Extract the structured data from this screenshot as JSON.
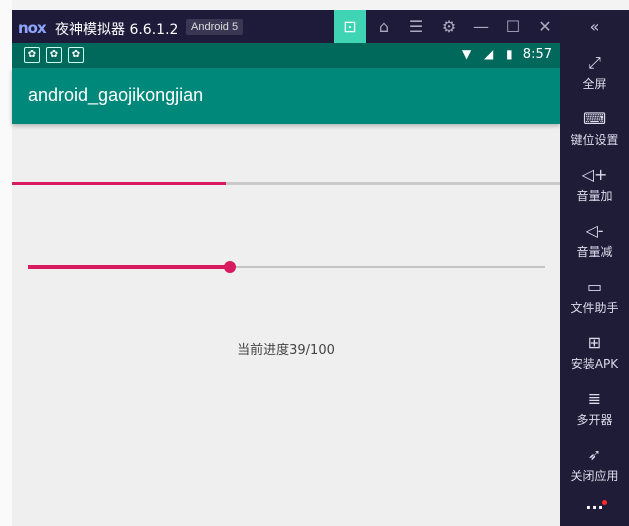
{
  "emulator": {
    "logo": "nox",
    "title": "夜神模拟器 6.6.1.2",
    "android_badge": "Android 5",
    "controls": [
      {
        "name": "store-icon",
        "glyph": "⊡"
      },
      {
        "name": "skin-icon",
        "glyph": "⌂"
      },
      {
        "name": "menu-icon",
        "glyph": "☰"
      },
      {
        "name": "settings-icon",
        "glyph": "⚙"
      },
      {
        "name": "minimize-icon",
        "glyph": "—"
      },
      {
        "name": "maximize-icon",
        "glyph": "☐"
      },
      {
        "name": "close-icon",
        "glyph": "✕"
      }
    ]
  },
  "statusbar": {
    "time": "8:57"
  },
  "app": {
    "title": "android_gaojikongjian",
    "progress_fraction": 0.39,
    "seek_fraction": 0.39,
    "progress_text": "当前进度39/100"
  },
  "sidebar": {
    "collapse_glyph": "«",
    "items": [
      {
        "label": "全屏",
        "glyph": "⤢"
      },
      {
        "label": "键位设置",
        "glyph": "⌨"
      },
      {
        "label": "音量加",
        "glyph": "◁+"
      },
      {
        "label": "音量减",
        "glyph": "◁-"
      },
      {
        "label": "文件助手",
        "glyph": "▭"
      },
      {
        "label": "安装APK",
        "glyph": "⊞"
      },
      {
        "label": "多开器",
        "glyph": "≣"
      },
      {
        "label": "关闭应用",
        "glyph": "➶"
      }
    ],
    "more_glyph": "···"
  }
}
